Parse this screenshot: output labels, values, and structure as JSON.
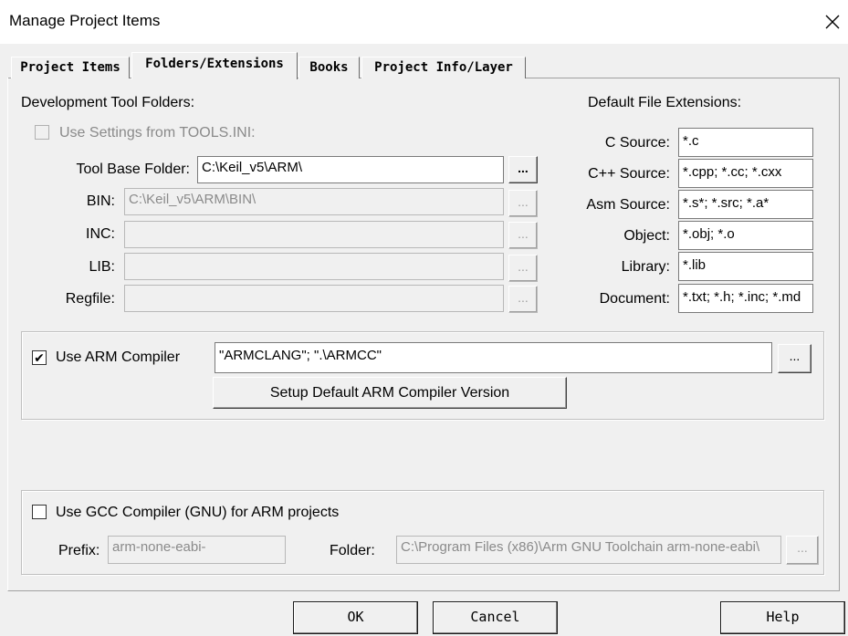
{
  "window": {
    "title": "Manage Project Items"
  },
  "tabs": [
    {
      "label": "Project Items"
    },
    {
      "label": "Folders/Extensions"
    },
    {
      "label": "Books"
    },
    {
      "label": "Project Info/Layer"
    }
  ],
  "dev_tools": {
    "heading": "Development Tool Folders:",
    "use_tools_ini_label": "Use Settings from TOOLS.INI:",
    "tool_base_label": "Tool Base Folder:",
    "tool_base_value": "C:\\Keil_v5\\ARM\\",
    "bin_label": "BIN:",
    "bin_value": "C:\\Keil_v5\\ARM\\BIN\\",
    "inc_label": "INC:",
    "inc_value": "",
    "lib_label": "LIB:",
    "lib_value": "",
    "regfile_label": "Regfile:",
    "regfile_value": "",
    "browse_label": "..."
  },
  "extensions": {
    "heading": "Default File Extensions:",
    "c_label": "C Source:",
    "c_value": "*.c",
    "cpp_label": "C++ Source:",
    "cpp_value": "*.cpp; *.cc; *.cxx",
    "asm_label": "Asm Source:",
    "asm_value": "*.s*; *.src; *.a*",
    "obj_label": "Object:",
    "obj_value": "*.obj; *.o",
    "lib_label": "Library:",
    "lib_value": "*.lib",
    "doc_label": "Document:",
    "doc_value": "*.txt; *.h; *.inc; *.md"
  },
  "arm": {
    "checkbox_label": "Use ARM Compiler",
    "checked_mark": "✔",
    "compiler_value": "\"ARMCLANG\"; \".\\ARMCC\"",
    "browse_label": "...",
    "setup_button": "Setup Default ARM Compiler Version"
  },
  "gcc": {
    "checkbox_label": "Use GCC Compiler (GNU) for ARM projects",
    "prefix_label": "Prefix:",
    "prefix_value": "arm-none-eabi-",
    "folder_label": "Folder:",
    "folder_value": "C:\\Program Files (x86)\\Arm GNU Toolchain arm-none-eabi\\",
    "browse_label": "..."
  },
  "buttons": {
    "ok": "OK",
    "cancel": "Cancel",
    "help": "Help"
  },
  "icons": {
    "close": "close-icon"
  }
}
